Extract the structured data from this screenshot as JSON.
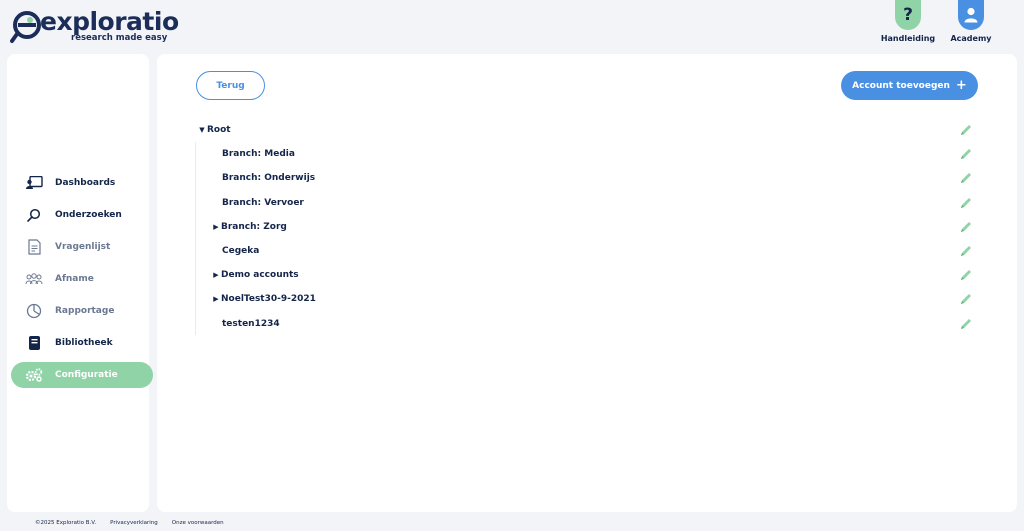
{
  "brand": {
    "name": "exploratio",
    "tagline": "research made easy",
    "color": "#1b2d58",
    "accent_green": "#8fd3a6",
    "accent_blue": "#4a90e2"
  },
  "header": {
    "help": {
      "label": "Handleiding",
      "icon": "question-icon"
    },
    "academy": {
      "label": "Academy",
      "icon": "user-icon"
    }
  },
  "sidebar": {
    "items": [
      {
        "label": "Dashboards",
        "icon": "dashboard-icon",
        "state": "normal"
      },
      {
        "label": "Onderzoeken",
        "icon": "search-icon",
        "state": "normal"
      },
      {
        "label": "Vragenlijst",
        "icon": "document-icon",
        "state": "dim"
      },
      {
        "label": "Afname",
        "icon": "users-icon",
        "state": "dim"
      },
      {
        "label": "Rapportage",
        "icon": "pie-chart-icon",
        "state": "dim"
      },
      {
        "label": "Bibliotheek",
        "icon": "library-icon",
        "state": "normal"
      },
      {
        "label": "Configuratie",
        "icon": "gears-icon",
        "state": "active"
      }
    ]
  },
  "main": {
    "back_label": "Terug",
    "add_label": "Account toevoegen",
    "tree": [
      {
        "label": "Root",
        "level": 0,
        "caret": "down"
      },
      {
        "label": "Branch: Media",
        "level": 1,
        "caret": "none"
      },
      {
        "label": "Branch: Onderwijs",
        "level": 1,
        "caret": "none"
      },
      {
        "label": "Branch: Vervoer",
        "level": 1,
        "caret": "none"
      },
      {
        "label": "Branch: Zorg",
        "level": 1,
        "caret": "right"
      },
      {
        "label": "Cegeka",
        "level": 1,
        "caret": "none"
      },
      {
        "label": "Demo accounts",
        "level": 1,
        "caret": "right"
      },
      {
        "label": "NoelTest30-9-2021",
        "level": 1,
        "caret": "right"
      },
      {
        "label": "testen1234",
        "level": 1,
        "caret": "none"
      }
    ]
  },
  "footer": {
    "copyright": "©2025 Exploratio B.V.",
    "privacy": "Privacyverklaring",
    "terms": "Onze voorwaarden"
  }
}
